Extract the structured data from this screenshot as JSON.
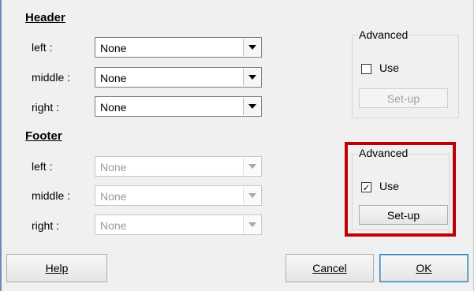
{
  "header": {
    "title": "Header",
    "rows": [
      {
        "label": "left :",
        "value": "None"
      },
      {
        "label": "middle :",
        "value": "None"
      },
      {
        "label": "right :",
        "value": "None"
      }
    ],
    "advanced": {
      "legend": "Advanced",
      "use_label": "Use",
      "use_checked": false,
      "setup_label": "Set-up",
      "setup_enabled": false
    }
  },
  "footer": {
    "title": "Footer",
    "rows": [
      {
        "label": "left :",
        "value": "None"
      },
      {
        "label": "middle :",
        "value": "None"
      },
      {
        "label": "right :",
        "value": "None"
      }
    ],
    "advanced": {
      "legend": "Advanced",
      "use_label": "Use",
      "use_checked": true,
      "check_mark": "✓",
      "setup_label": "Set-up",
      "setup_enabled": true
    }
  },
  "buttons": {
    "help": "Help",
    "cancel": "Cancel",
    "ok": "OK"
  },
  "colors": {
    "highlight": "#c00000",
    "dialog_bg": "#f0f0f0"
  }
}
